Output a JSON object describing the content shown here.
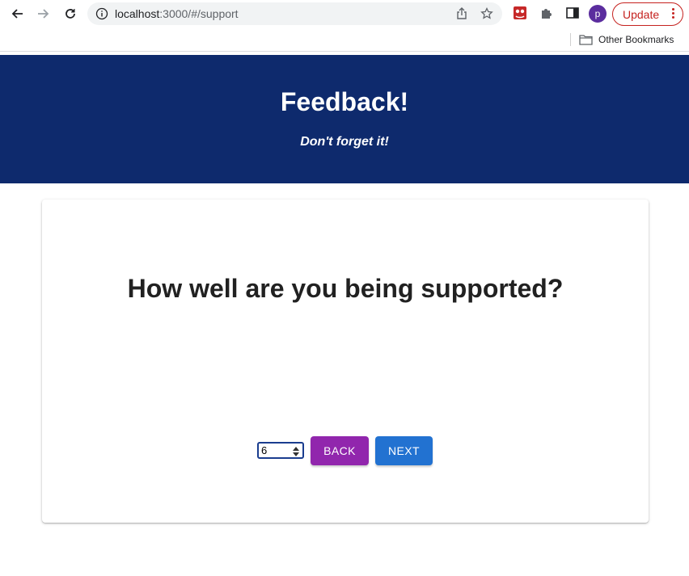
{
  "browser": {
    "url_host": "localhost",
    "url_path": ":3000/#/support",
    "profile_initial": "p",
    "update_label": "Update",
    "bookmarks_folder": "Other Bookmarks"
  },
  "header": {
    "title": "Feedback!",
    "subtitle": "Don't forget it!",
    "background": "#0e2a6d"
  },
  "card": {
    "question": "How well are you being supported?",
    "rating_value": "6",
    "back_label": "BACK",
    "next_label": "NEXT",
    "back_color": "#9126ad",
    "next_color": "#2272d1"
  }
}
